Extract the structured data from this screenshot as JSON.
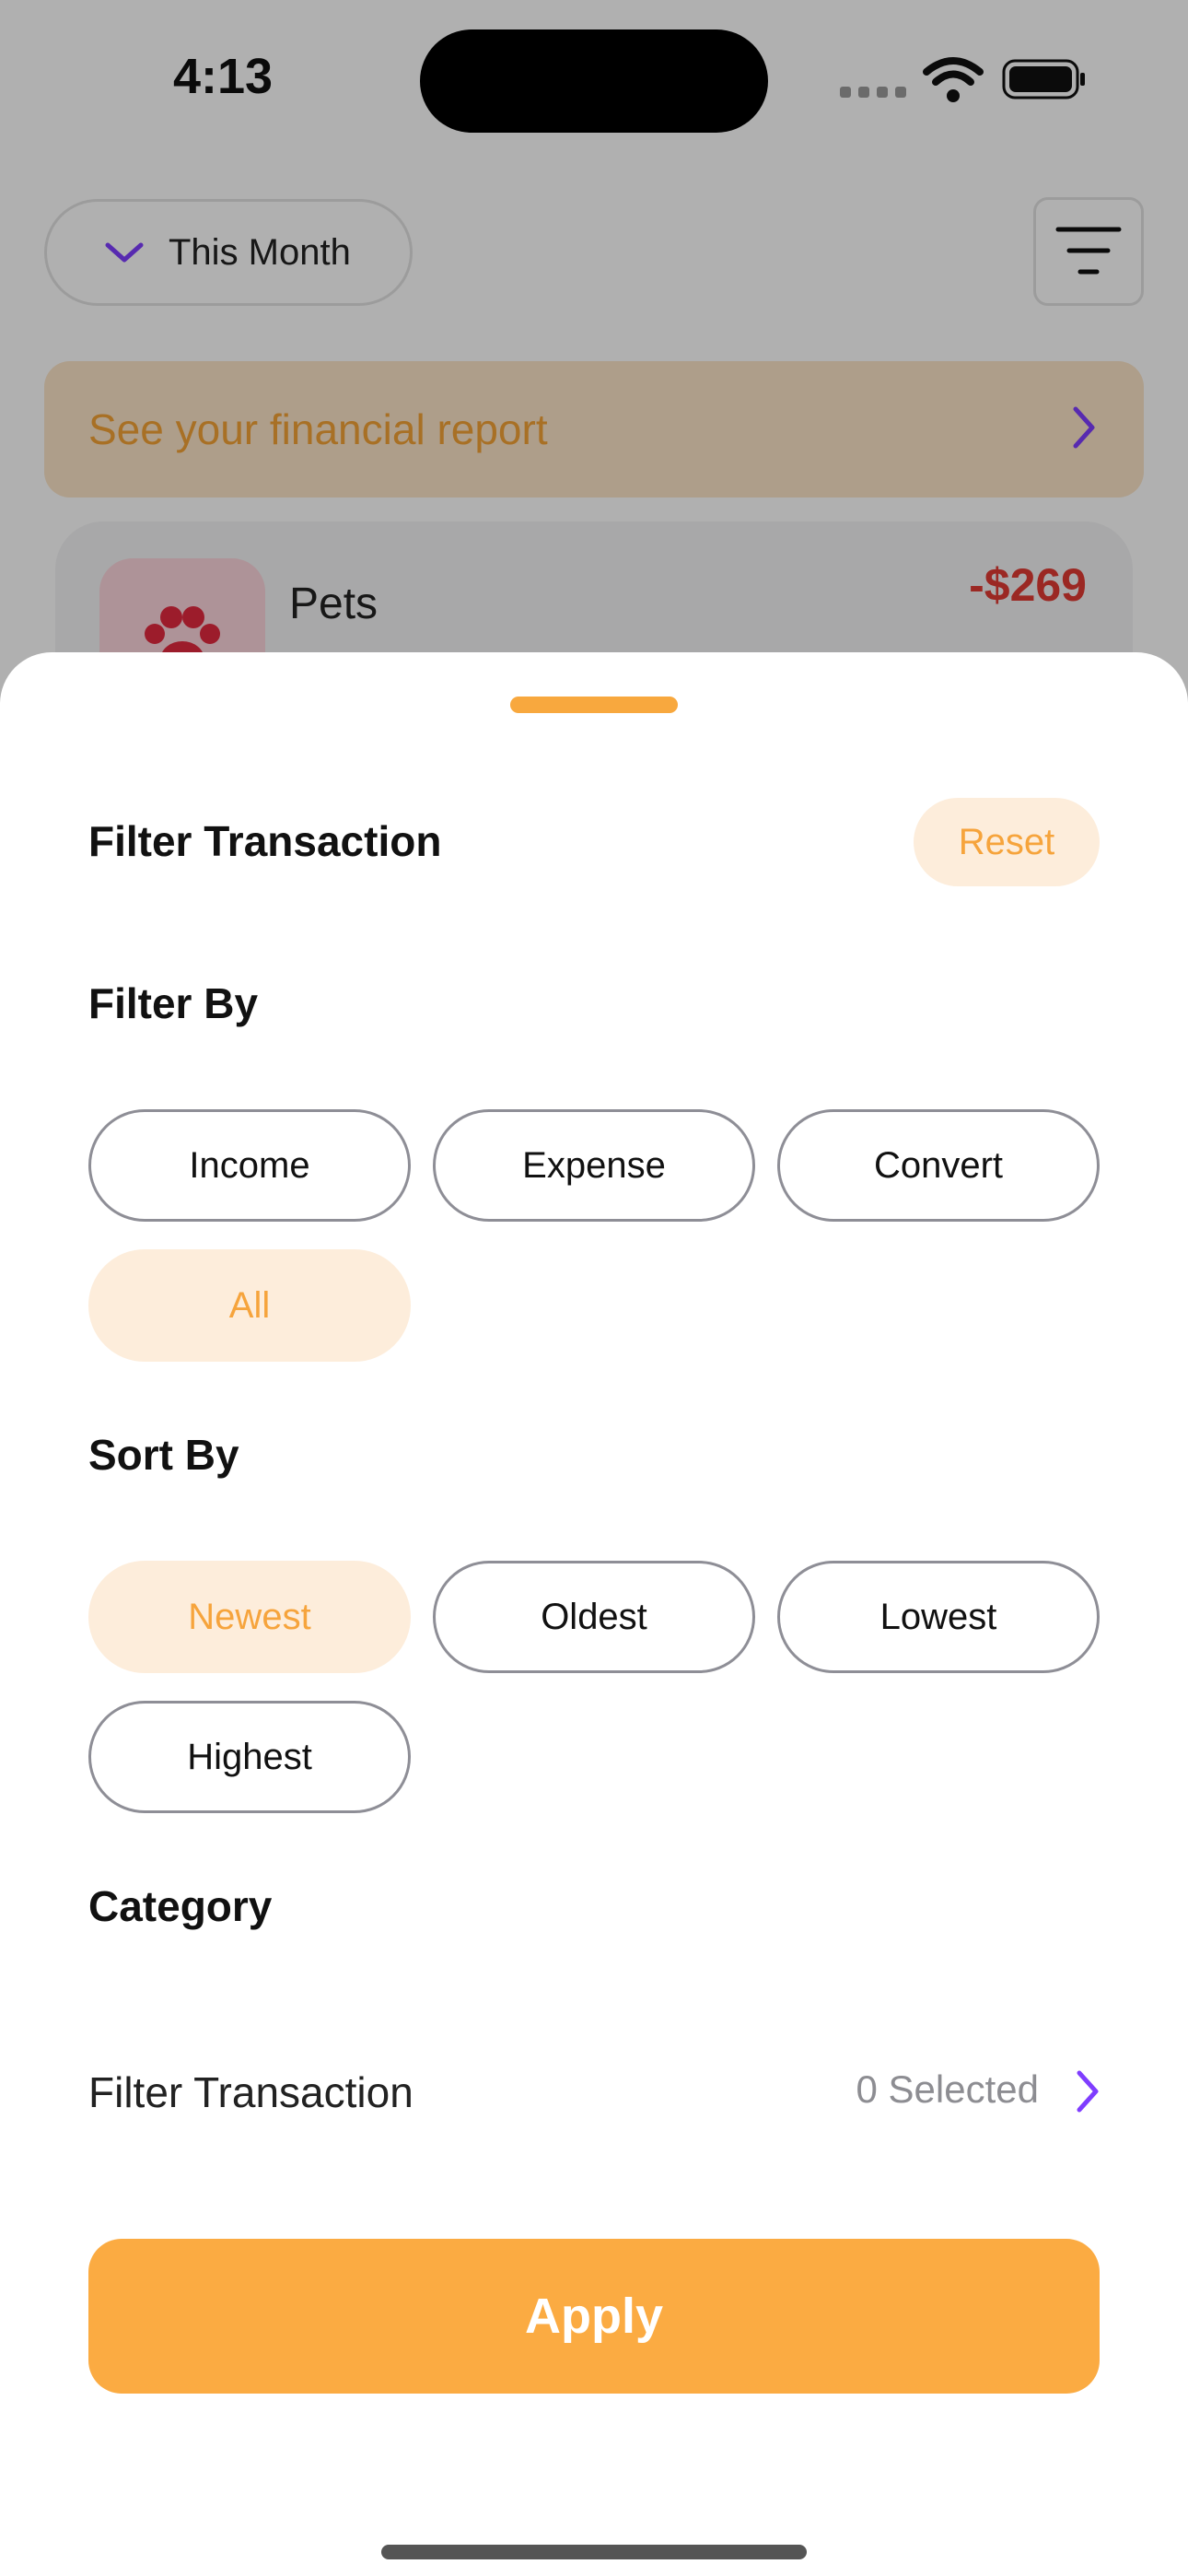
{
  "status_bar": {
    "time": "4:13"
  },
  "background": {
    "period_selector": "This Month",
    "report_banner": "See your financial report",
    "transaction": {
      "name": "Pets",
      "amount": "-$269"
    }
  },
  "sheet": {
    "title": "Filter Transaction",
    "reset_label": "Reset",
    "filter_by": {
      "label": "Filter By",
      "options": [
        "Income",
        "Expense",
        "Convert",
        "All"
      ],
      "selected": "All"
    },
    "sort_by": {
      "label": "Sort By",
      "options": [
        "Newest",
        "Oldest",
        "Lowest",
        "Highest"
      ],
      "selected": "Newest"
    },
    "category": {
      "label": "Category",
      "row_label": "Filter Transaction",
      "selected_text": "0 Selected"
    },
    "apply_label": "Apply"
  },
  "colors": {
    "accent": "#FBAB42",
    "accent_soft": "#FDEDDB",
    "chevron": "#7F3DFF",
    "expense_red": "#E13B33"
  }
}
